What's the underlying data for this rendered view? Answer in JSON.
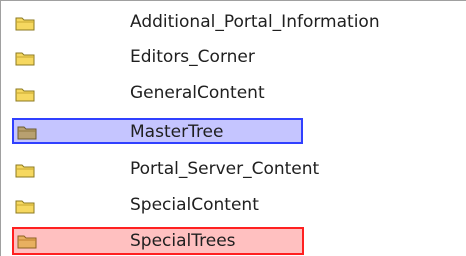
{
  "folders": [
    {
      "label": "Additional_Portal_Information",
      "state": "normal"
    },
    {
      "label": "Editors_Corner",
      "state": "normal"
    },
    {
      "label": "GeneralContent",
      "state": "normal"
    },
    {
      "label": "MasterTree",
      "state": "selected"
    },
    {
      "label": "Portal_Server_Content",
      "state": "normal"
    },
    {
      "label": "SpecialContent",
      "state": "normal"
    },
    {
      "label": "SpecialTrees",
      "state": "highlighted"
    }
  ],
  "colors": {
    "folder_fill": "#f6d860",
    "folder_stroke": "#8c7a20",
    "selected_border": "#3040ff",
    "highlight_border": "#ff2020"
  },
  "icons": {
    "folder": "folder-icon"
  }
}
